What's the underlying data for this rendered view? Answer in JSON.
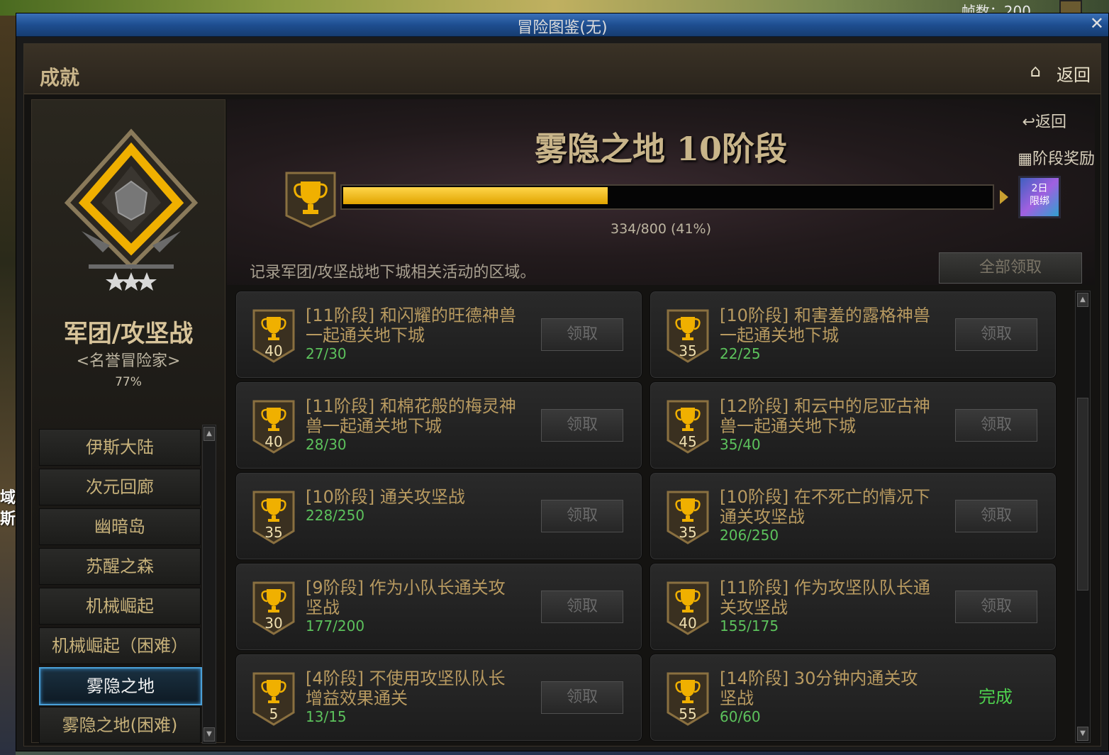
{
  "background": {
    "fps_label": "帧数：200",
    "side_text": "域\n斯家"
  },
  "window": {
    "title": "冒险图鉴(无)",
    "close": "✕"
  },
  "section": {
    "title": "成就",
    "home_icon": "⌂",
    "back": "返回"
  },
  "category": {
    "name": "军团/攻坚战",
    "subtitle": "<名誉冒险家>",
    "percent": "77%"
  },
  "areas": [
    {
      "label": "伊斯大陆"
    },
    {
      "label": "次元回廊"
    },
    {
      "label": "幽暗岛"
    },
    {
      "label": "苏醒之森"
    },
    {
      "label": "机械崛起"
    },
    {
      "label": "机械崛起（困难）"
    },
    {
      "label": "雾隐之地",
      "selected": true
    },
    {
      "label": "雾隐之地(困难)"
    }
  ],
  "stage": {
    "title": "雾隐之地 10阶段",
    "back": "返回",
    "reward_label": "阶段奖励",
    "progress_text": "334/800 (41%)",
    "progress_fraction": 0.41,
    "reward_item_text": "2日\n限绑",
    "description": "记录军团/攻坚战地下城相关活动的区域。",
    "claim_all": "全部领取"
  },
  "achievements": [
    {
      "points": "40",
      "title": "[11阶段] 和闪耀的旺德神兽一起通关地下城",
      "progress": "27/30",
      "action": "领取",
      "done": false
    },
    {
      "points": "35",
      "title": "[10阶段] 和害羞的露格神兽一起通关地下城",
      "progress": "22/25",
      "action": "领取",
      "done": false
    },
    {
      "points": "40",
      "title": "[11阶段] 和棉花般的梅灵神兽一起通关地下城",
      "progress": "28/30",
      "action": "领取",
      "done": false
    },
    {
      "points": "45",
      "title": "[12阶段] 和云中的尼亚古神兽一起通关地下城",
      "progress": "35/40",
      "action": "领取",
      "done": false
    },
    {
      "points": "35",
      "title": "[10阶段] 通关攻坚战",
      "progress": "228/250",
      "action": "领取",
      "done": false
    },
    {
      "points": "35",
      "title": "[10阶段] 在不死亡的情况下通关攻坚战",
      "progress": "206/250",
      "action": "领取",
      "done": false
    },
    {
      "points": "30",
      "title": "[9阶段] 作为小队长通关攻坚战",
      "progress": "177/200",
      "action": "领取",
      "done": false
    },
    {
      "points": "40",
      "title": "[11阶段] 作为攻坚队队长通关攻坚战",
      "progress": "155/175",
      "action": "领取",
      "done": false
    },
    {
      "points": "5",
      "title": "[4阶段] 不使用攻坚队队长增益效果通关",
      "progress": "13/15",
      "action": "领取",
      "done": false
    },
    {
      "points": "55",
      "title": "[14阶段] 30分钟内通关攻坚战",
      "progress": "60/60",
      "action": "完成",
      "done": true
    }
  ],
  "colors": {
    "accent_gold": "#e0a400",
    "progress_green": "#5cc25c",
    "done_green": "#4ed04e",
    "title_gold": "#b89a60",
    "selected_blue": "#4aa0d8"
  }
}
